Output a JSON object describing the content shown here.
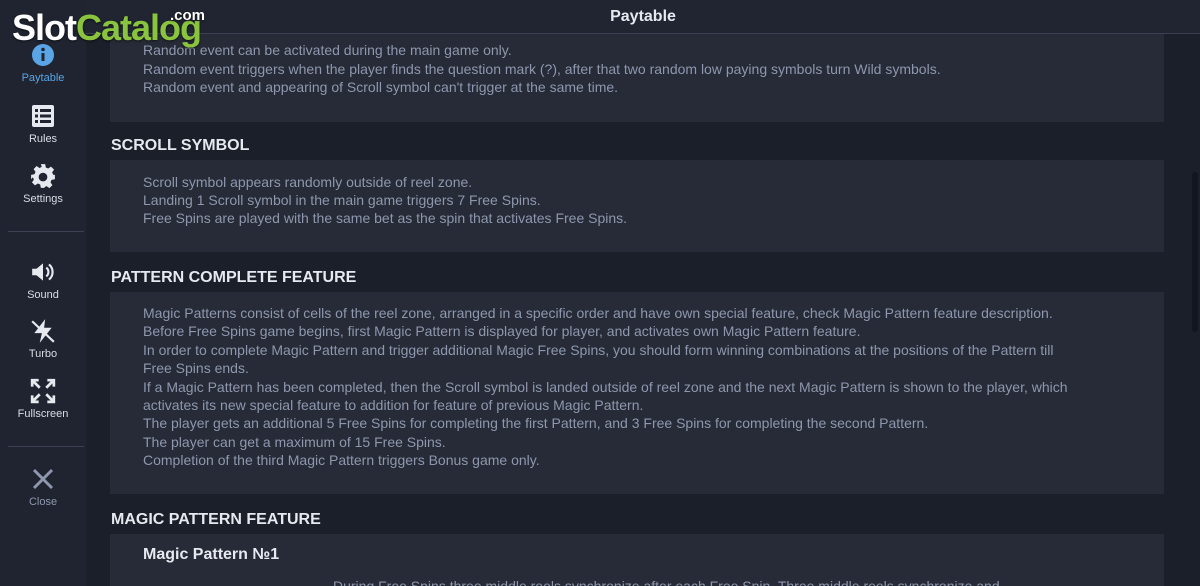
{
  "header": {
    "title": "Paytable"
  },
  "watermark": {
    "slot": "Slot",
    "catalog": "Catalog",
    "com": ".com"
  },
  "sidebar": {
    "items": [
      {
        "label": "Paytable",
        "icon": "info-icon",
        "active": true
      },
      {
        "label": "Rules",
        "icon": "list-icon"
      },
      {
        "label": "Settings",
        "icon": "gear-icon"
      },
      {
        "label": "Sound",
        "icon": "speaker-icon"
      },
      {
        "label": "Turbo",
        "icon": "lightning-icon"
      },
      {
        "label": "Fullscreen",
        "icon": "fullscreen-icon"
      },
      {
        "label": "Close",
        "icon": "close-icon"
      }
    ]
  },
  "random_event": {
    "lines": [
      "Random event can be activated during the main game only.",
      "Random event triggers when the player finds the question mark (?), after that two random low paying symbols turn Wild symbols.",
      "Random event and appearing of Scroll symbol can't trigger at the same time."
    ]
  },
  "scroll_symbol": {
    "title": "SCROLL SYMBOL",
    "lines": [
      "Scroll symbol appears randomly outside of reel zone.",
      "Landing 1 Scroll symbol in the main game triggers 7 Free Spins.",
      "Free Spins are played with the same bet as the spin that activates Free Spins."
    ]
  },
  "pattern_complete": {
    "title": "PATTERN COMPLETE FEATURE",
    "lines": [
      "Magic Patterns consist of cells of the reel zone, arranged in a specific order and have own special feature, check Magic Pattern feature description.",
      "Before Free Spins game begins, first Magic Pattern is displayed for player, and activates own Magic Pattern feature.",
      "In order to complete Magic Pattern and trigger additional Magic Free Spins, you should form winning combinations at the positions of the Pattern till",
      "Free Spins ends.",
      "If a Magic Pattern has been completed, then the Scroll symbol is landed outside of reel zone and the next Magic Pattern is shown to the player, which",
      "activates its new special feature to addition for feature of previous Magic Pattern.",
      "The player gets an additional 5 Free Spins for completing the first Pattern, and 3 Free Spins for completing the second Pattern.",
      "The player can get a maximum of 15 Free Spins.",
      "Completion of the third Magic Pattern triggers Bonus game only."
    ]
  },
  "magic_pattern": {
    "title": "MAGIC PATTERN FEATURE",
    "subtitle": "Magic Pattern №1",
    "partial_line": "During Free Spins three middle reels synchronize after each Free Spin. Three middle reels synchronize and"
  },
  "colors": {
    "background": "#1b1f2a",
    "panel": "#262b37",
    "accent": "#5aa5e6",
    "brand_green": "#8ac43f"
  }
}
